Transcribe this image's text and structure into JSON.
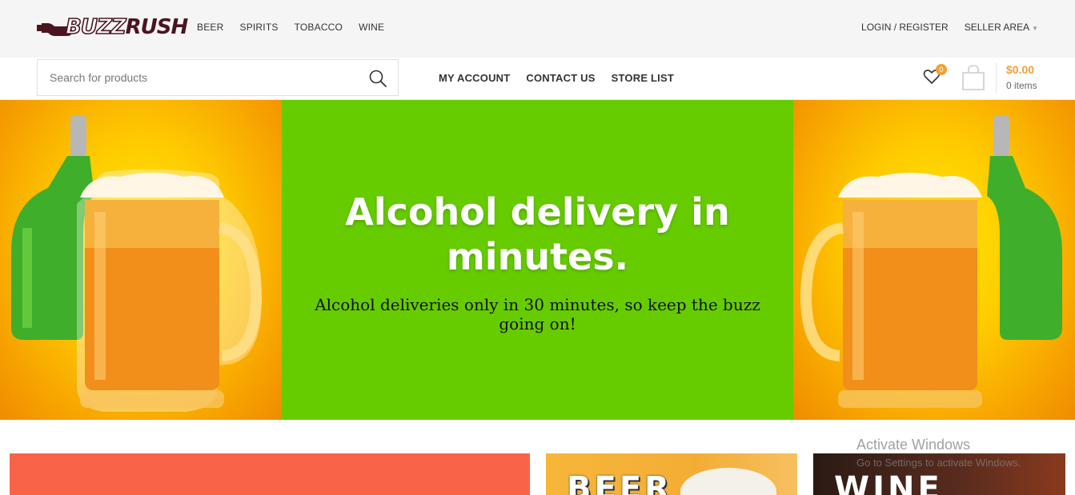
{
  "brand": {
    "logo_text": "BUZZ RUSH"
  },
  "topbar": {
    "nav": [
      "BEER",
      "SPIRITS",
      "TOBACCO",
      "WINE"
    ],
    "login_label": "LOGIN / REGISTER",
    "seller_label": "SELLER AREA"
  },
  "search": {
    "placeholder": "Search for products",
    "value": ""
  },
  "mainnav": [
    "MY ACCOUNT",
    "CONTACT US",
    "STORE LIST"
  ],
  "wishlist": {
    "count": "0"
  },
  "cart": {
    "total": "$0.00",
    "items": "0 items"
  },
  "hero": {
    "title": "Alcohol delivery in minutes.",
    "subtitle": "Alcohol deliveries only in 30 minutes, so keep the buzz going on!"
  },
  "categories": [
    "BEER",
    "WINE"
  ],
  "watermark": {
    "title": "Activate Windows",
    "subtitle": "Go to Settings to activate Windows."
  },
  "colors": {
    "accent": "#f0a034",
    "hero_green": "#66cc00",
    "hero_yellow": "#ffcc00",
    "card_red": "#f96449"
  }
}
